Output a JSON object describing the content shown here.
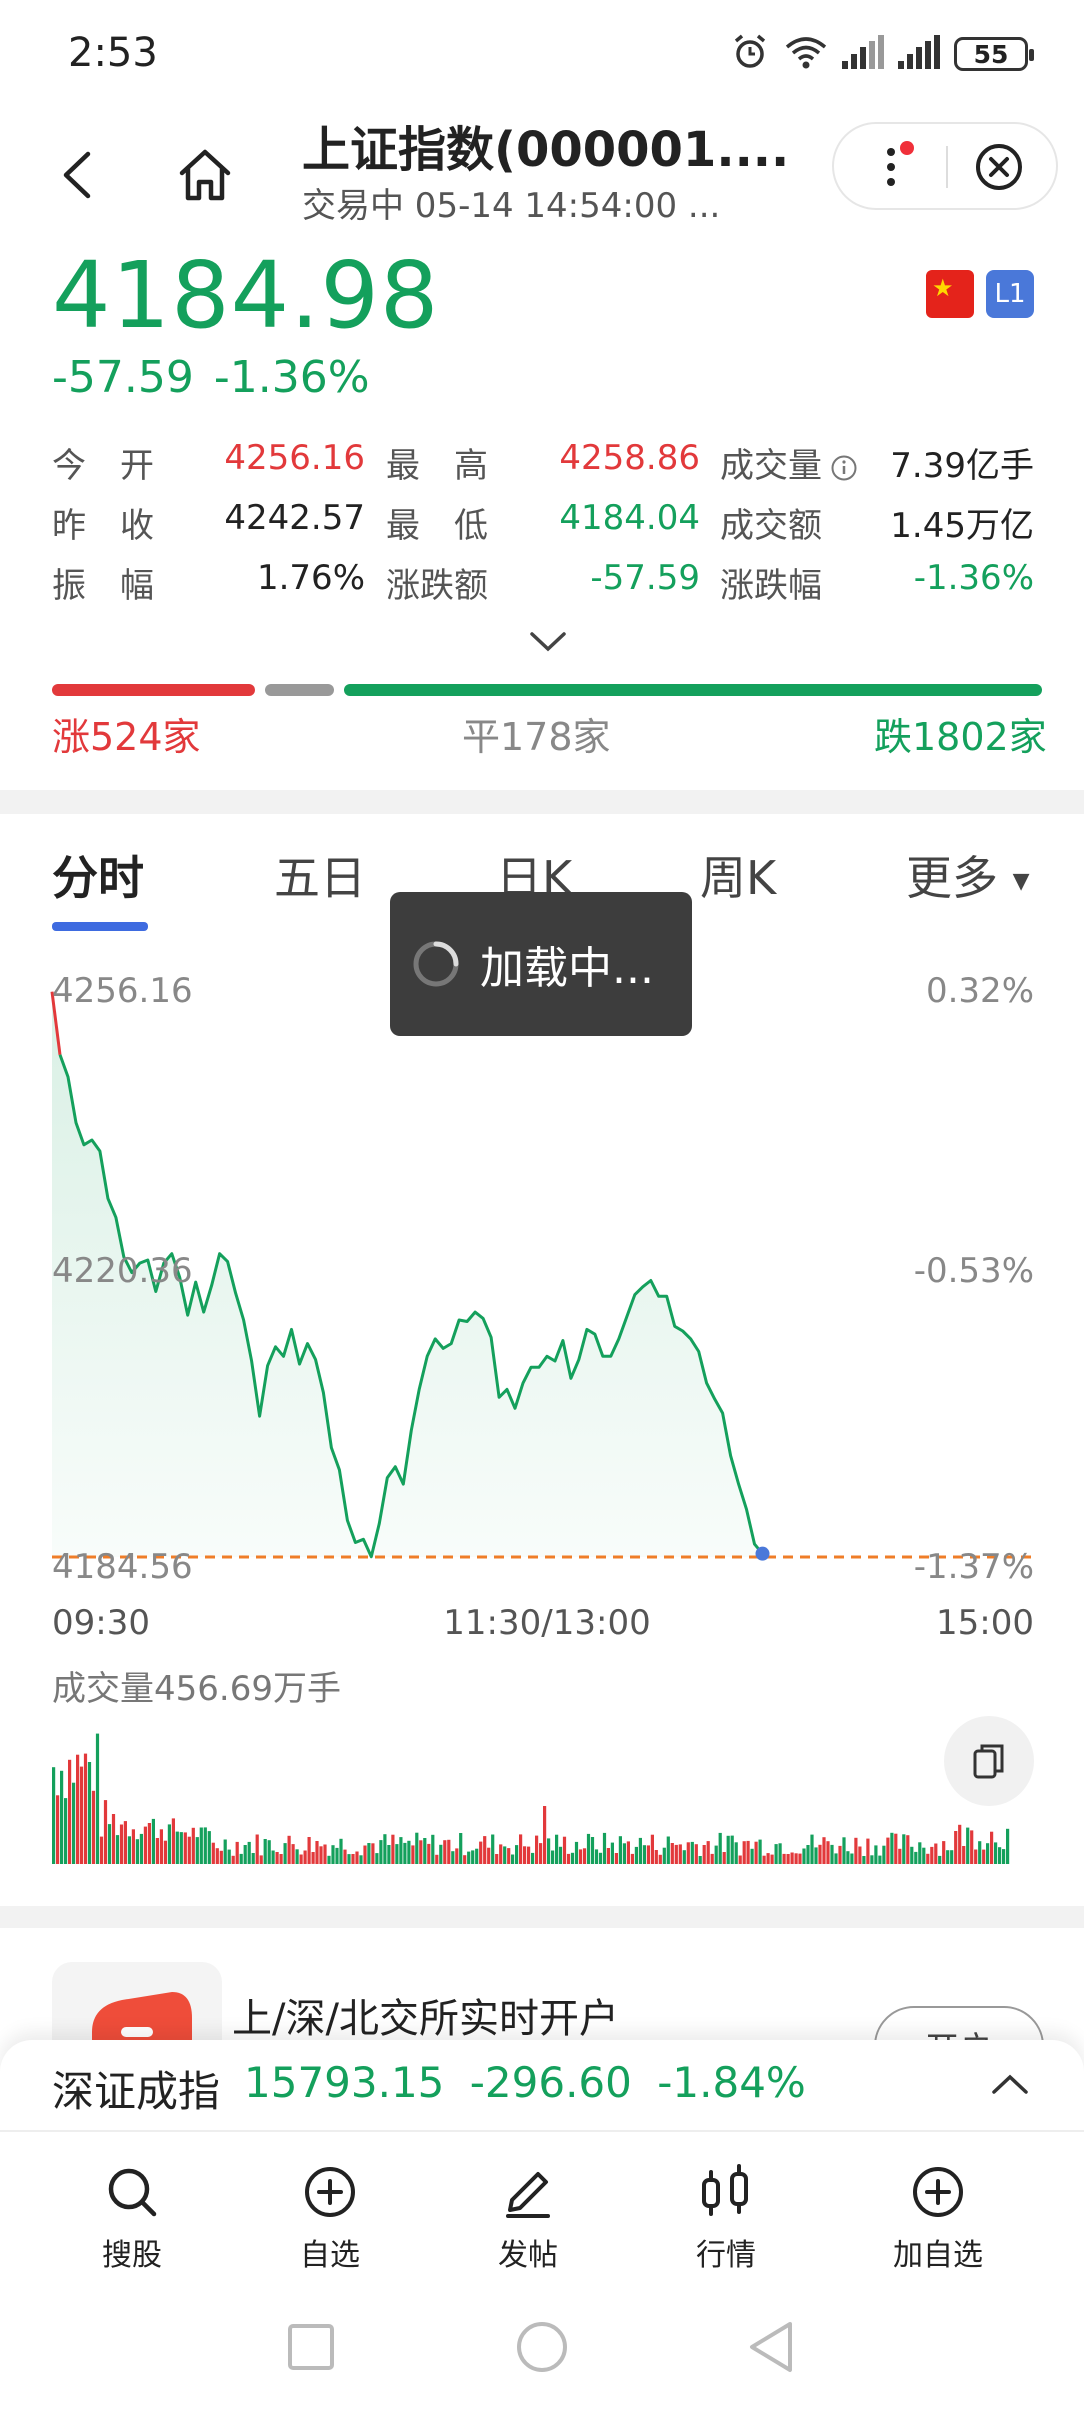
{
  "status_bar": {
    "time": "2:53",
    "battery": "55"
  },
  "header": {
    "title": "上证指数(000001....",
    "subtitle": "交易中 05-14 14:54:00 ..."
  },
  "quote": {
    "price": "4184.98",
    "change": "-57.59",
    "change_pct": "-1.36%",
    "badges": {
      "flag": "CN",
      "level": "L1"
    },
    "stats": [
      {
        "label": "今　开",
        "value": "4256.16",
        "color": "#e2393b"
      },
      {
        "label": "最　高",
        "value": "4258.86",
        "color": "#e2393b"
      },
      {
        "label": "成交量",
        "value": "7.39亿手",
        "color": "#222222"
      },
      {
        "label": "昨　收",
        "value": "4242.57",
        "color": "#222222"
      },
      {
        "label": "最　低",
        "value": "4184.04",
        "color": "#14a05c"
      },
      {
        "label": "成交额",
        "value": "1.45万亿",
        "color": "#222222"
      },
      {
        "label": "振　幅",
        "value": "1.76%",
        "color": "#222222"
      },
      {
        "label": "涨跌额",
        "value": "-57.59",
        "color": "#14a05c"
      },
      {
        "label": "涨跌幅",
        "value": "-1.36%",
        "color": "#14a05c"
      }
    ]
  },
  "breadth": {
    "up": "涨524家",
    "flat": "平178家",
    "down": "跌1802家",
    "up_n": 524,
    "flat_n": 178,
    "down_n": 1802
  },
  "tabs": [
    {
      "label": "分时",
      "active": true
    },
    {
      "label": "五日",
      "active": false
    },
    {
      "label": "日K",
      "active": false
    },
    {
      "label": "周K",
      "active": false
    },
    {
      "label": "更多",
      "active": false
    }
  ],
  "loading": {
    "text": "加载中..."
  },
  "chart_data": {
    "type": "line",
    "y_left_labels": [
      "4256.16",
      "4220.36",
      "4184.56"
    ],
    "y_right_labels": [
      "0.32%",
      "-0.53%",
      "-1.37%"
    ],
    "x_labels": [
      "09:30",
      "11:30/13:00",
      "15:00"
    ],
    "ylim": [
      4184.56,
      4256.16
    ],
    "prev_close": 4242.57,
    "x": [
      0,
      2,
      4,
      6,
      8,
      10,
      12,
      14,
      16,
      18,
      20,
      22,
      24,
      26,
      28,
      30,
      32,
      34,
      36,
      38,
      40,
      42,
      44,
      46,
      48,
      50,
      52,
      54,
      56,
      58,
      60,
      62,
      64,
      66,
      68,
      70,
      72,
      74,
      76,
      78,
      80,
      82,
      84,
      86,
      88,
      90,
      92,
      94,
      96,
      98,
      100,
      102,
      104,
      106,
      108,
      110,
      112,
      114,
      116,
      118,
      120,
      122,
      124,
      126,
      128,
      130,
      132,
      134,
      136,
      138,
      140,
      142,
      144,
      146,
      148,
      150,
      152,
      154,
      156,
      158,
      160,
      162,
      164,
      166,
      168,
      170,
      172,
      174,
      176,
      178,
      180,
      182,
      184,
      186,
      188,
      190,
      192,
      194,
      196,
      198,
      200,
      202,
      204,
      206,
      208,
      210,
      212,
      214,
      216,
      218,
      220,
      222,
      224,
      226,
      228,
      230,
      232,
      234,
      236,
      238,
      240
    ],
    "values": [
      4256.2,
      4248.2,
      4245.4,
      4239.6,
      4236.8,
      4237.4,
      4236.0,
      4230.0,
      4227.6,
      4222.6,
      4220.6,
      4221.8,
      4222.2,
      4218.2,
      4221.8,
      4223.0,
      4220.0,
      4215.2,
      4219.4,
      4215.6,
      4219.0,
      4223.0,
      4222.0,
      4218.0,
      4214.6,
      4209.4,
      4202.4,
      4208.8,
      4211.2,
      4210.0,
      4213.4,
      4209.0,
      4211.6,
      4209.6,
      4205.4,
      4198.4,
      4195.6,
      4189.2,
      4186.4,
      4186.8,
      4184.6,
      4188.8,
      4194.6,
      4196.0,
      4193.8,
      4200.6,
      4205.8,
      4210.0,
      4212.2,
      4211.0,
      4211.6,
      4214.6,
      4214.4,
      4215.6,
      4214.8,
      4212.4,
      4204.8,
      4205.8,
      4203.4,
      4206.6,
      4208.6,
      4208.6,
      4210.0,
      4209.4,
      4212.0,
      4207.2,
      4209.6,
      4213.4,
      4212.8,
      4210.0,
      4210.0,
      4212.2,
      4215.0,
      4217.8,
      4218.8,
      4219.6,
      4217.6,
      4217.6,
      4213.8,
      4213.2,
      4212.2,
      4210.6,
      4206.6,
      4204.6,
      4202.8,
      4197.4,
      4193.8,
      4190.6,
      4186.2,
      4184.98
    ]
  },
  "volume": {
    "label": "成交量456.69万手"
  },
  "promo": {
    "text": "上/深/北交所实时开户",
    "button": "开户"
  },
  "ticker": {
    "name": "深证成指",
    "price": "15793.15",
    "change": "-296.60",
    "change_pct": "-1.84%"
  },
  "bottom_nav": [
    {
      "label": "搜股",
      "icon": "search-icon"
    },
    {
      "label": "自选",
      "icon": "add-circle-icon"
    },
    {
      "label": "发帖",
      "icon": "pen-icon"
    },
    {
      "label": "行情",
      "icon": "candlestick-icon"
    },
    {
      "label": "加自选",
      "icon": "add-circle-icon"
    }
  ],
  "colors": {
    "up": "#e2393b",
    "down": "#14a05c",
    "accent": "#3e6be0",
    "flat": "#999999"
  }
}
